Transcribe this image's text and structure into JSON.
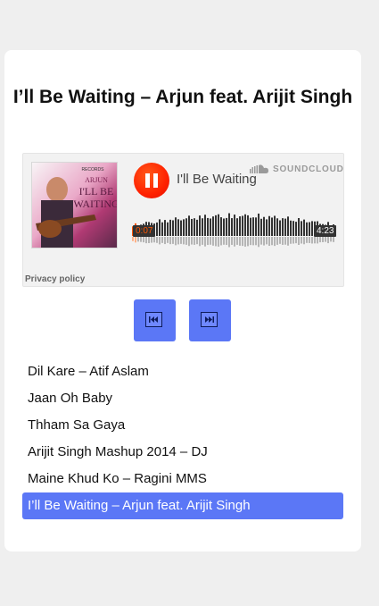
{
  "player": {
    "title": "I’ll Be Waiting – Arjun feat. Arijit Singh",
    "accent_color": "#5b77f6"
  },
  "widget": {
    "track_name": "I'll Be Waiting",
    "brand": "SOUNDCLOUD",
    "elapsed": "0:07",
    "duration": "4:23",
    "progress": 0.027,
    "privacy_label": "Privacy policy",
    "cover_texts": {
      "label_badge": "RECORDS",
      "artist": "ARJUN",
      "title_line1": "I'LL BE",
      "title_line2": "WAITING"
    },
    "play_state": "playing",
    "play_color": "#ff3300",
    "icons": [
      "pause-icon",
      "soundcloud-icon"
    ]
  },
  "controls": {
    "prev_icon": "skip-previous-icon",
    "next_icon": "skip-next-icon"
  },
  "playlist": {
    "items": [
      "Dil Kare – Atif Aslam",
      "Jaan Oh Baby",
      "Thham Sa Gaya",
      "Arijit Singh Mashup 2014 – DJ",
      "Maine Khud Ko – Ragini MMS",
      "I’ll Be Waiting – Arjun feat. Arijit Singh"
    ],
    "active_index": 5
  }
}
